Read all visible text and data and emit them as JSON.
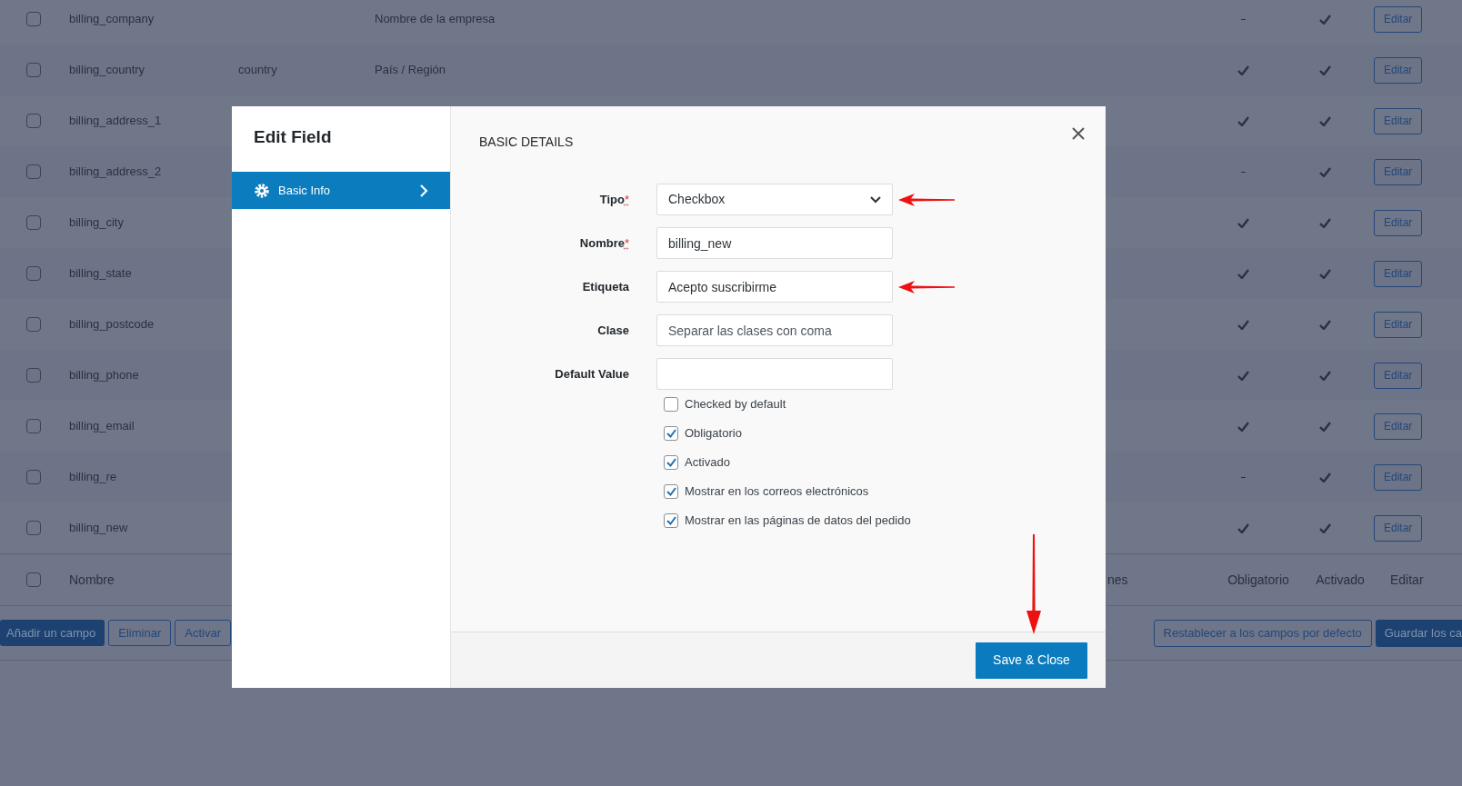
{
  "table": {
    "rows": [
      {
        "name": "billing_company",
        "type": "",
        "label": "Nombre de la empresa",
        "checked": false,
        "required": false,
        "enabled": true,
        "action": "Editar"
      },
      {
        "name": "billing_country",
        "type": "country",
        "label": "País / Región",
        "checked": false,
        "required": true,
        "enabled": true,
        "action": "Editar"
      },
      {
        "name": "billing_address_1",
        "type": "",
        "label": "",
        "checked": false,
        "required": true,
        "enabled": true,
        "action": "Editar"
      },
      {
        "name": "billing_address_2",
        "type": "",
        "label": "",
        "checked": false,
        "required": false,
        "enabled": true,
        "action": "Editar"
      },
      {
        "name": "billing_city",
        "type": "",
        "label": "",
        "checked": false,
        "required": true,
        "enabled": true,
        "action": "Editar"
      },
      {
        "name": "billing_state",
        "type": "",
        "label": "",
        "checked": false,
        "required": true,
        "enabled": true,
        "action": "Editar"
      },
      {
        "name": "billing_postcode",
        "type": "",
        "label": "",
        "checked": false,
        "required": true,
        "enabled": true,
        "action": "Editar"
      },
      {
        "name": "billing_phone",
        "type": "",
        "label": "",
        "checked": false,
        "required": true,
        "enabled": true,
        "action": "Editar"
      },
      {
        "name": "billing_email",
        "type": "",
        "label": "",
        "checked": false,
        "required": true,
        "enabled": true,
        "action": "Editar"
      },
      {
        "name": "billing_re",
        "type": "",
        "label": "",
        "checked": false,
        "required": false,
        "enabled": true,
        "action": "Editar"
      },
      {
        "name": "billing_new",
        "type": "",
        "label": "",
        "checked": false,
        "required": true,
        "enabled": true,
        "action": "Editar"
      }
    ],
    "footer": {
      "checked": false,
      "name": "Nombre",
      "column_3": "nes",
      "required": "Obligatorio",
      "enabled": "Activado",
      "action": "Editar"
    }
  },
  "actions_left": [
    "Añadir un campo",
    "Eliminar",
    "Activar"
  ],
  "actions_right": [
    "Restablecer a los campos por defecto",
    "Guardar los ca"
  ],
  "modal": {
    "title": "Edit Field",
    "tabs": [
      {
        "label": "Basic Info",
        "selected": true
      }
    ],
    "section_title": "BASIC DETAILS",
    "fields": [
      {
        "kind": "select",
        "label": "Tipo",
        "required_mark": "*",
        "value": "Checkbox",
        "arrow": true
      },
      {
        "kind": "text",
        "label": "Nombre",
        "required_mark": "*",
        "value": "billing_new",
        "arrow": false
      },
      {
        "kind": "text",
        "label": "Etiqueta",
        "value": "Acepto suscribirme",
        "arrow": true
      },
      {
        "kind": "text",
        "label": "Clase",
        "placeholder": "Separar las clases con coma",
        "arrow": false
      },
      {
        "kind": "text",
        "label": "Default Value",
        "arrow": false
      }
    ],
    "checkboxes": [
      {
        "label": "Checked by default",
        "checked": false
      },
      {
        "label": "Obligatorio",
        "checked": true
      },
      {
        "label": "Activado",
        "checked": true
      },
      {
        "label": "Mostrar en los correos electrónicos",
        "checked": true
      },
      {
        "label": "Mostrar en las páginas de datos del pedido",
        "checked": true
      }
    ],
    "save_button": {
      "label": "Save & Close",
      "arrow": true
    }
  }
}
